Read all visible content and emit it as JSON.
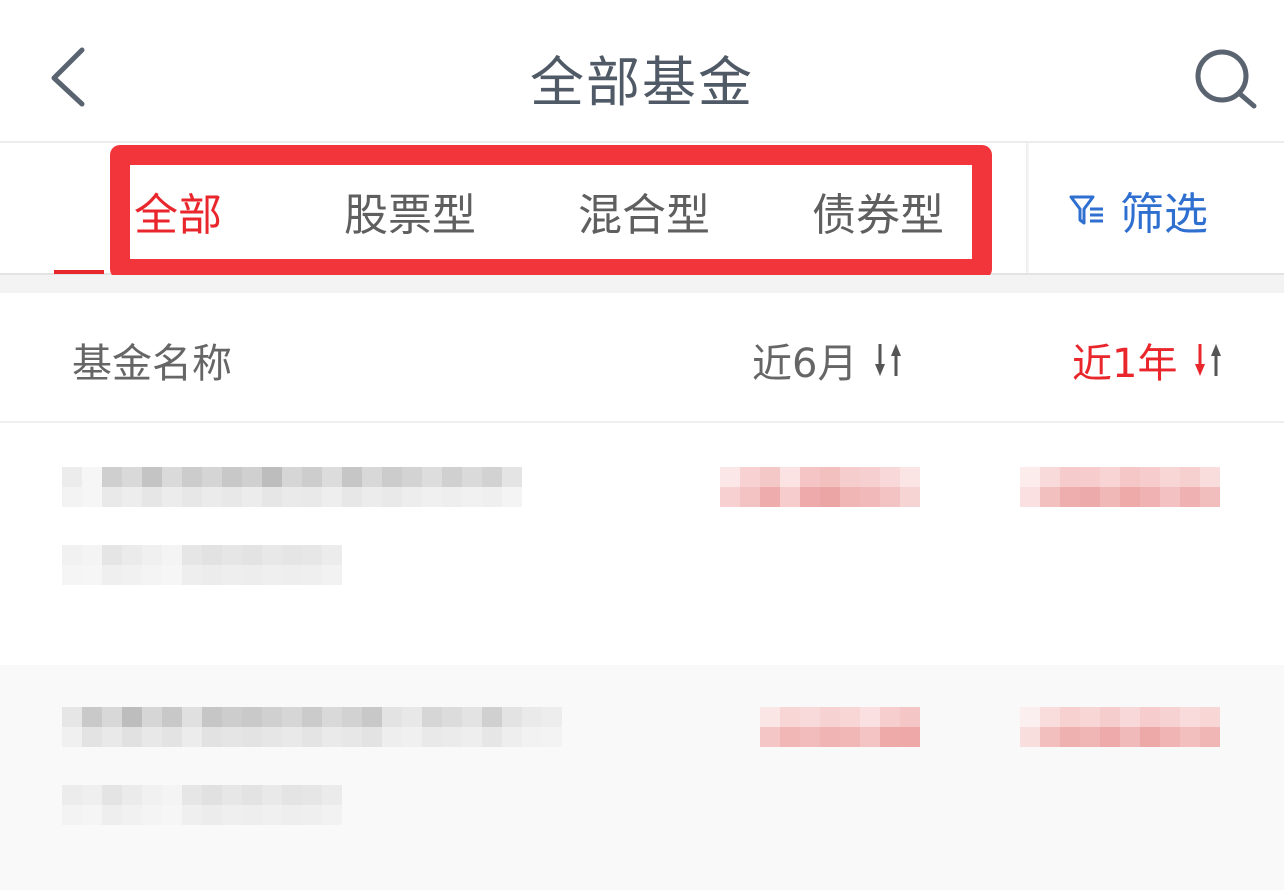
{
  "header": {
    "title": "全部基金",
    "back_icon": "chevron-left-icon",
    "search_icon": "search-icon"
  },
  "tabs": [
    {
      "label": "全部",
      "active": true
    },
    {
      "label": "股票型",
      "active": false
    },
    {
      "label": "混合型",
      "active": false
    },
    {
      "label": "债券型",
      "active": false
    }
  ],
  "filter": {
    "label": "筛选",
    "icon": "filter-icon"
  },
  "columns": {
    "name": "基金名称",
    "six_month": "近6月",
    "one_year": "近1年",
    "sort_icon": "sort-arrows-icon"
  },
  "colors": {
    "accent": "#e8262b",
    "link": "#2e6fd0",
    "highlight": "#f2353a"
  }
}
